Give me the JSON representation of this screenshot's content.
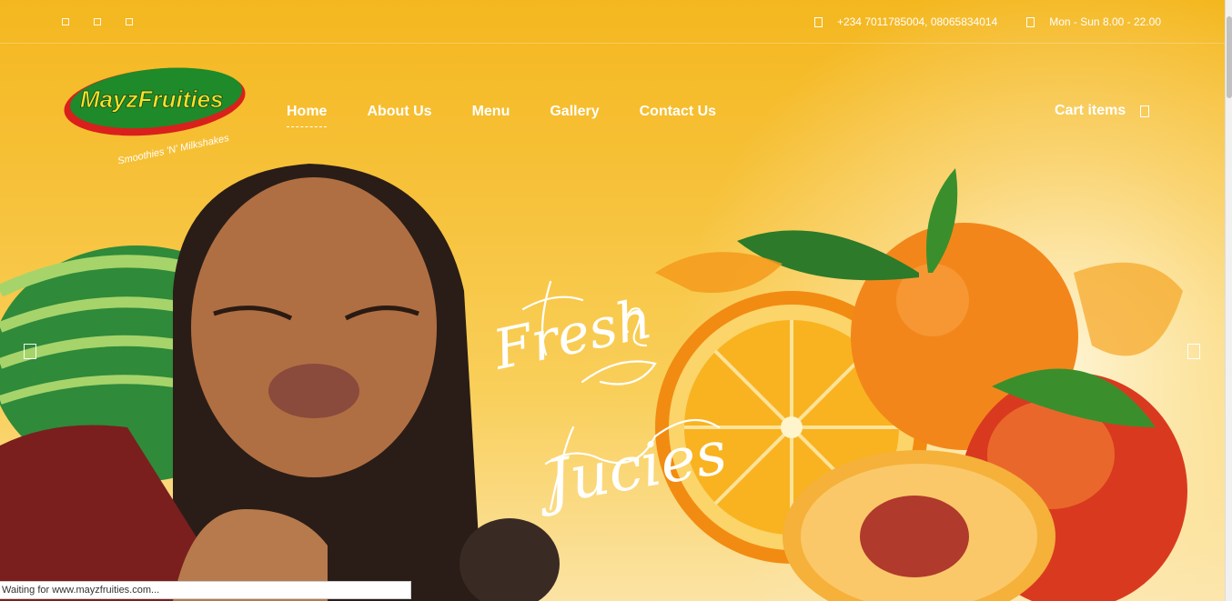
{
  "topbar": {
    "social_icons": [
      "social-icon-1",
      "social-icon-2",
      "social-icon-3"
    ],
    "phone_icon": "phone-icon",
    "phone": "+234 7011785004, 08065834014",
    "clock_icon": "clock-icon",
    "hours": "Mon - Sun 8.00 - 22.00"
  },
  "logo": {
    "brand": "MayzFruities",
    "tagline": "Smoothies 'N' Milkshakes"
  },
  "nav": {
    "items": [
      {
        "label": "Home"
      },
      {
        "label": "About Us"
      },
      {
        "label": "Menu"
      },
      {
        "label": "Gallery"
      },
      {
        "label": "Contact Us"
      }
    ],
    "cart_label": "Cart items",
    "cart_icon": "cart-icon"
  },
  "hero": {
    "headline_line1": "Fresh",
    "headline_line2": "Jucies"
  },
  "status_bar": {
    "text": "Waiting for www.mayzfruities.com..."
  },
  "colors": {
    "primary_yellow": "#f4b71f",
    "logo_green": "#1e8a2a",
    "logo_red": "#d9201c",
    "logo_yellow_text": "#f5e12a"
  }
}
